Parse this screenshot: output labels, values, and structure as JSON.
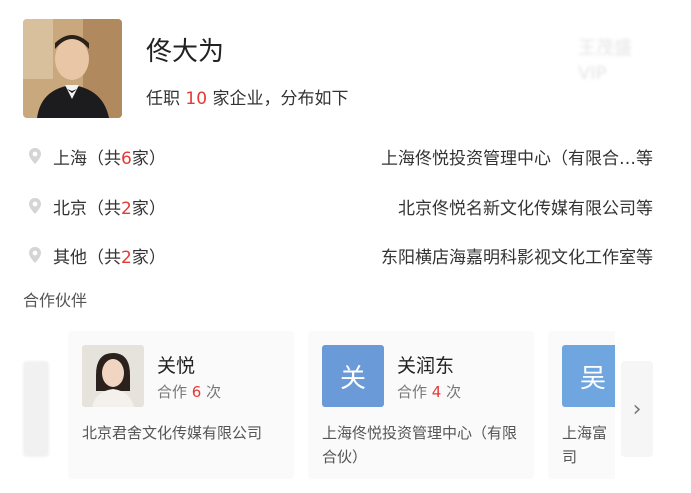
{
  "profile": {
    "name": "佟大为",
    "summary_prefix": "任职",
    "company_count": "10",
    "summary_suffix": "家企业，分布如下",
    "watermark_line1": "王茂盛",
    "watermark_line2": "VIP"
  },
  "locations": [
    {
      "name": "上海",
      "count_prefix": "（共",
      "count": "6",
      "count_suffix": "家）",
      "companies": "上海佟悦投资管理中心（有限合…等"
    },
    {
      "name": "北京",
      "count_prefix": "（共",
      "count": "2",
      "count_suffix": "家）",
      "companies": "北京佟悦名新文化传媒有限公司等"
    },
    {
      "name": "其他",
      "count_prefix": "（共",
      "count": "2",
      "count_suffix": "家）",
      "companies": "东阳横店海嘉明科影视文化工作室等"
    }
  ],
  "partners": {
    "title": "合作伙伴",
    "next_arrow": "›",
    "items": [
      {
        "name": "关悦",
        "count_prefix": "合作",
        "count": "6",
        "count_suffix": "次",
        "company": "北京君舍文化传媒有限公司",
        "avatar": "photo"
      },
      {
        "name": "关润东",
        "count_prefix": "合作",
        "count": "4",
        "count_suffix": "次",
        "company": "上海佟悦投资管理中心（有限合伙）",
        "avatar_letter": "关",
        "avatar_color": "#6b9ad9"
      },
      {
        "avatar_letter": "吴",
        "company": "上海富\n司",
        "avatar_color": "#6fa6e0"
      }
    ]
  },
  "colors": {
    "accent": "#e53935",
    "avatar_blue": "#6b9ad9"
  }
}
